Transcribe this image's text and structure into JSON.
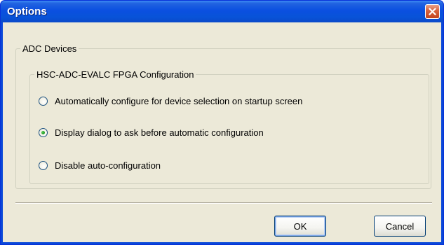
{
  "window": {
    "title": "Options"
  },
  "groups": {
    "adc_devices": {
      "label": "ADC Devices"
    },
    "fpga_config": {
      "label": "HSC-ADC-EVALC FPGA Configuration"
    }
  },
  "options": [
    {
      "label": "Automatically configure for device selection on startup screen",
      "checked": false
    },
    {
      "label": "Display dialog to ask before automatic configuration",
      "checked": true
    },
    {
      "label": "Disable auto-configuration",
      "checked": false
    }
  ],
  "buttons": {
    "ok_label": "OK",
    "cancel_label": "Cancel"
  },
  "icons": {
    "close": "close-icon",
    "radio": "radio-button"
  },
  "colors": {
    "titlebar": "#0a4fe0",
    "close_button": "#d9653f",
    "dialog_background": "#ece9d8",
    "radio_dot": "#21a121"
  }
}
